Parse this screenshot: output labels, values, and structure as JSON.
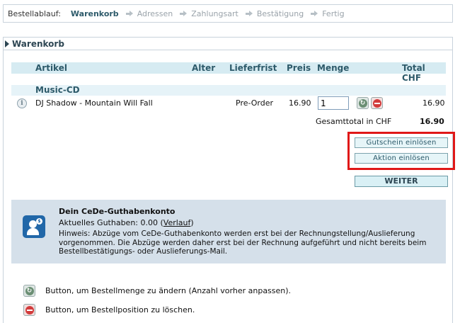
{
  "breadcrumb": {
    "label": "Bestellablauf:",
    "steps": [
      "Warenkorb",
      "Adressen",
      "Zahlungsart",
      "Bestätigung",
      "Fertig"
    ]
  },
  "panel": {
    "title": "Warenkorb"
  },
  "table": {
    "headers": {
      "artikel": "Artikel",
      "alter": "Alter",
      "lieferfrist": "Lieferfrist",
      "preis": "Preis",
      "menge": "Menge",
      "total": "Total CHF"
    },
    "category": "Music-CD",
    "items": [
      {
        "title": "DJ Shadow - Mountain Will Fall",
        "lieferfrist": "Pre-Order",
        "preis": "16.90",
        "menge": "1",
        "total": "16.90"
      }
    ],
    "gesamttotal_label": "Gesamttotal in CHF",
    "gesamttotal_value": "16.90"
  },
  "actions": {
    "gutschein": "Gutschein einlösen",
    "aktion": "Aktion einlösen",
    "weiter": "WEITER"
  },
  "credit": {
    "title": "Dein CeDe-Guthabenkonto",
    "balance_prefix": "Aktuelles Guthaben: 0.00 (",
    "history_link": "Verlauf",
    "balance_suffix": ")",
    "note": "Hinweis: Abzüge vom CeDe-Guthabenkonto werden erst bei der Rechnungstellung/Auslieferung vorgenommen. Die Abzüge werden daher erst bei der Rechnung aufgeführt und nicht bereits beim Bestellbestätigungs- oder Auslieferungs-Mail."
  },
  "legend": {
    "update": "Button, um Bestellmenge zu ändern (Anzahl vorher anpassen).",
    "delete": "Button, um Bestellposition zu löschen."
  },
  "colors": {
    "accent": "#2d5a6a",
    "header_bg": "#d6ebf2",
    "credit_bg": "#d5e0ea",
    "highlight": "#e01818",
    "delete_red": "#d23c3c",
    "update_green": "#6b8f74"
  },
  "icons": [
    "info-icon",
    "refresh-icon",
    "delete-icon",
    "user-coin-icon",
    "arrow-right-icon",
    "triangle-right-icon"
  ]
}
